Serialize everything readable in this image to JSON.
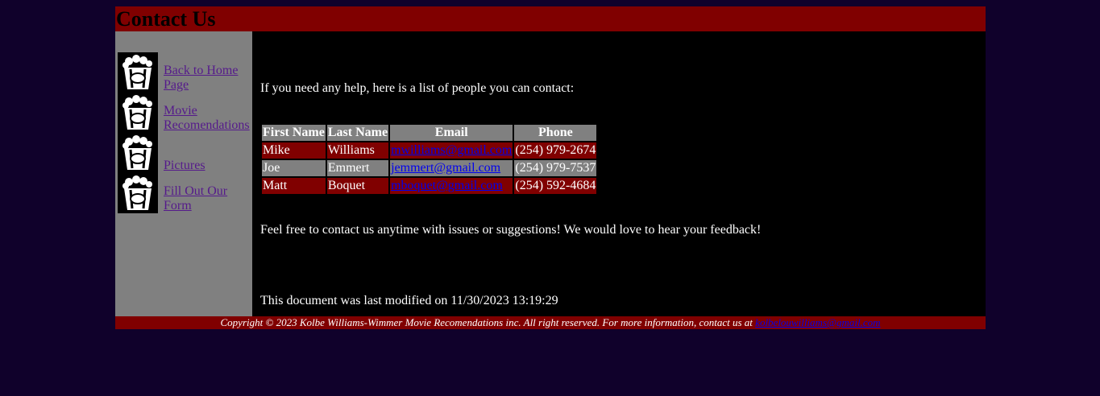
{
  "header": {
    "title": "Contact Us"
  },
  "sidebar": {
    "items": [
      {
        "label": "Back to Home Page",
        "icon": "popcorn-icon"
      },
      {
        "label": "Movie Recomendations",
        "icon": "popcorn-icon"
      },
      {
        "label": "Pictures",
        "icon": "popcorn-icon"
      },
      {
        "label": "Fill Out Our Form",
        "icon": "popcorn-icon"
      }
    ]
  },
  "main": {
    "intro": "If you need any help, here is a list of people you can contact:",
    "table": {
      "headers": [
        "First Name",
        "Last Name",
        "Email",
        "Phone"
      ],
      "rows": [
        {
          "first": "Mike",
          "last": "Williams",
          "email": "mwilliams@gmail.com",
          "phone": "(254) 979-2674"
        },
        {
          "first": "Joe",
          "last": "Emmert",
          "email": "jemmert@gmail.com",
          "phone": "(254) 979-7537"
        },
        {
          "first": "Matt",
          "last": "Boquet",
          "email": "mboquet@gmail.com",
          "phone": "(254) 592-4684"
        }
      ]
    },
    "feedback": "Feel free to contact us anytime with issues or suggestions! We would love to hear your feedback!",
    "modified": "This document was last modified on 11/30/2023 13:19:29"
  },
  "footer": {
    "text": "Copyright © 2023 Kolbe Williams-Wimmer Movie Recomendations inc. All right reserved. For more information, contact us at",
    "email": "kolbelouwilliams@gmail.com"
  },
  "colors": {
    "background": "#10012b",
    "accent": "#800000",
    "sidebar": "#808080",
    "content": "#000000"
  }
}
